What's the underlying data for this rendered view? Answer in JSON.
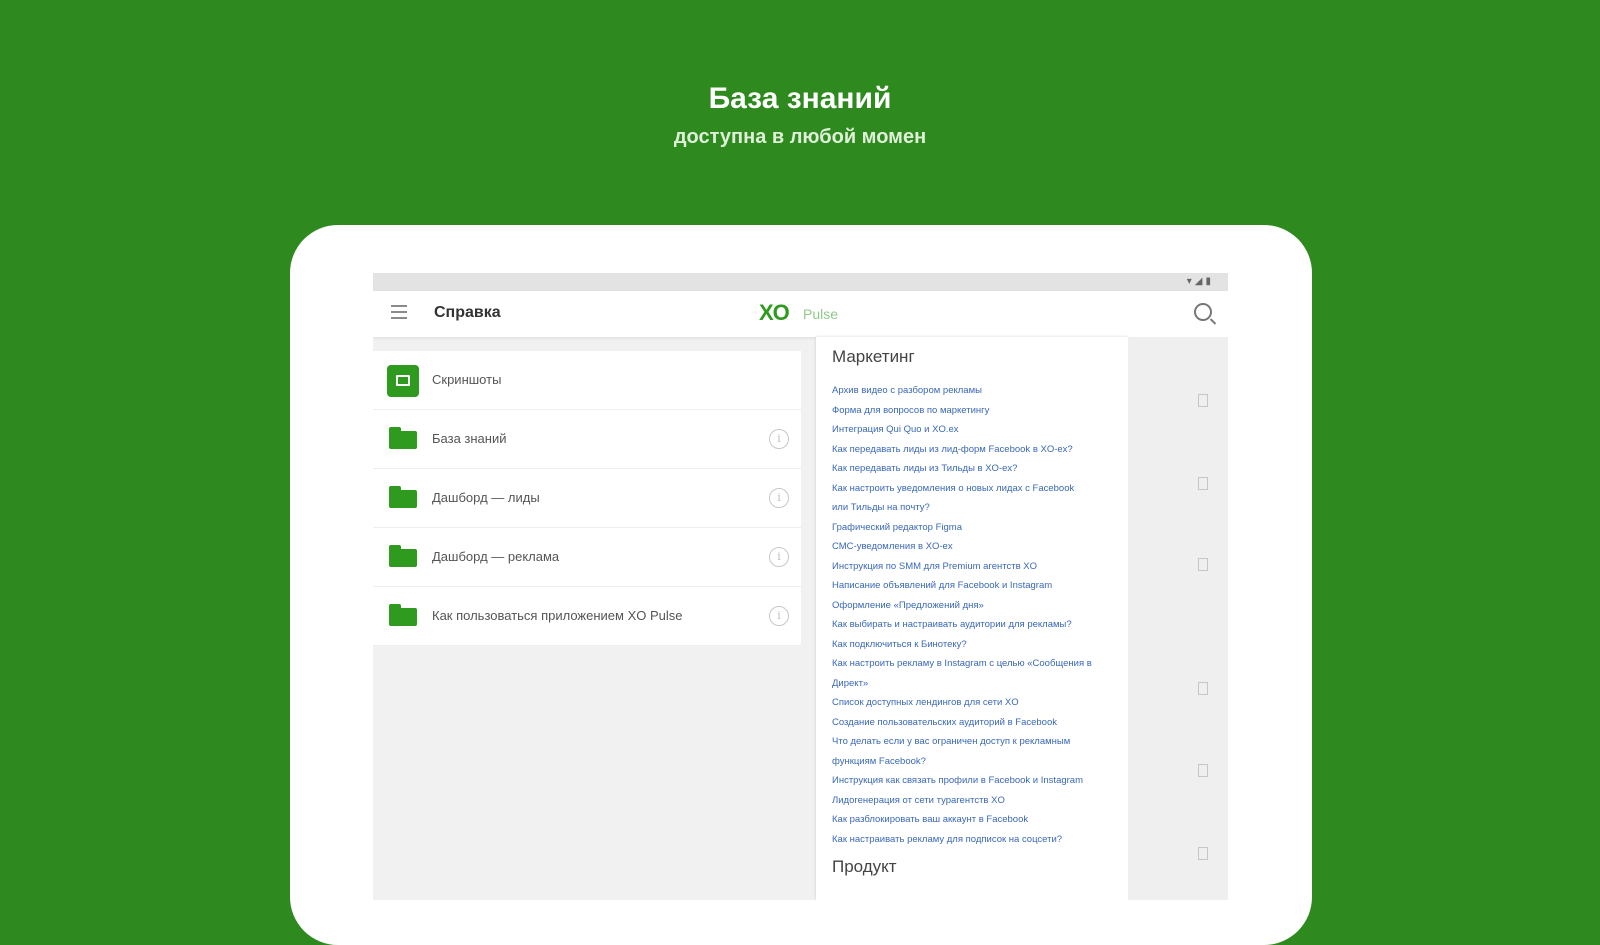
{
  "promo": {
    "title": "База знаний",
    "subtitle": "доступна в любой момен"
  },
  "app": {
    "title": "Справка",
    "logo_text": "XO",
    "logo_sub": "Pulse"
  },
  "list_items": [
    {
      "label": "Скриншоты",
      "icon": "image-icon",
      "info": false
    },
    {
      "label": "База знаний",
      "icon": "folder-icon",
      "info": true
    },
    {
      "label": "Дашборд — лиды",
      "icon": "folder-icon",
      "info": true
    },
    {
      "label": "Дашборд — реклама",
      "icon": "folder-icon",
      "info": true
    },
    {
      "label": "Как пользоваться приложением XO Pulse",
      "icon": "folder-icon",
      "info": true
    }
  ],
  "detail": {
    "sections": [
      {
        "title": "Маркетинг",
        "links": [
          "Архив видео с разбором рекламы",
          "Форма для вопросов по маркетингу",
          "Интеграция Qui Quo и XO.ex",
          "Как передавать лиды из лид-форм Facebook в XO-ex?",
          "Как передавать лиды из Тильды в XO-ex?",
          "Как настроить уведомления о новых лидах с Facebook",
          "или Тильды на почту?",
          "Графический редактор Figma",
          "СМС-уведомления в XO-ex",
          "Инструкция по SMM для Premium агентств XO",
          "Написание объявлений для Facebook и Instagram",
          "Оформление «Предложений дня»",
          "Как выбирать и настраивать аудитории для рекламы?",
          "Как подключиться к Бинотеку?",
          "Как настроить рекламу в Instagram с целью «Сообщения в",
          "Директ»",
          "Список доступных лендингов для сети XO",
          "Создание пользовательских аудиторий в Facebook",
          "Что делать если у вас ограничен доступ к рекламным",
          "функциям Facebook?",
          "Инструкция как связать профили в Facebook и Instagram",
          "Лидогенерация от сети турагентств XO",
          "Как разблокировать ваш аккаунт в Facebook",
          "Как настраивать рекламу для подписок на соцсети?"
        ]
      },
      {
        "title": "Продукт",
        "links": []
      }
    ]
  },
  "colors": {
    "background": "#2e8a1e",
    "accent": "#2e9a1e",
    "link": "#3a68b8"
  }
}
